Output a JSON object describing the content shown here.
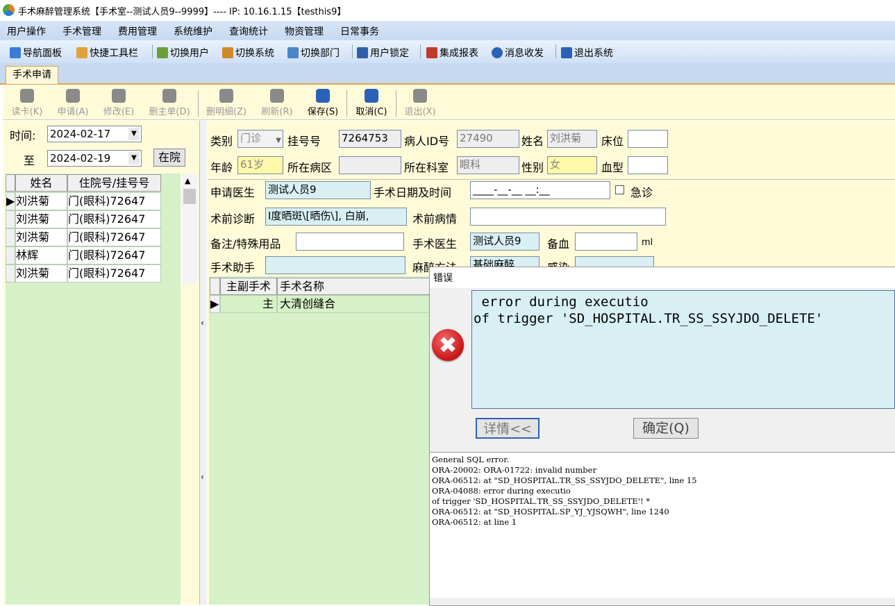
{
  "window": {
    "title": "手术麻醉管理系统【手术室--测试人员9--9999】---- IP:  10.16.1.15【testhis9】"
  },
  "menu": [
    "用户操作",
    "手术管理",
    "费用管理",
    "系统维护",
    "查询统计",
    "物资管理",
    "日常事务"
  ],
  "toolbar": [
    "导航面板",
    "快捷工具栏",
    "切换用户",
    "切换系统",
    "切换部门",
    "用户锁定",
    "集成报表",
    "消息收发",
    "退出系统"
  ],
  "tab": "手术申请",
  "actions": [
    "读卡(K)",
    "申请(A)",
    "修改(E)",
    "删主单(D)",
    "删明细(Z)",
    "刷新(R)",
    "保存(S)",
    "取消(C)",
    "退出(X)"
  ],
  "left": {
    "time_label": "时间:",
    "date_from": "2024-02-17",
    "to_label": "至",
    "date_to": "2024-02-19",
    "inhosp_button": "在院",
    "columns": [
      "姓名",
      "住院号/挂号号"
    ],
    "rows": [
      [
        "刘洪菊",
        "门(眼科)72647"
      ],
      [
        "刘洪菊",
        "门(眼科)72647"
      ],
      [
        "刘洪菊",
        "门(眼科)72647"
      ],
      [
        "林辉",
        "门(眼科)72647"
      ],
      [
        "刘洪菊",
        "门(眼科)72647"
      ]
    ]
  },
  "form": {
    "category_label": "类别",
    "category": "门诊",
    "reg_label": "挂号号",
    "reg_no": "7264753",
    "pid_label": "病人ID号",
    "pid": "27490",
    "name_label": "姓名",
    "name": "刘洪菊",
    "bed_label": "床位",
    "bed": "",
    "age_label": "年龄",
    "age": "61岁",
    "ward_label": "所在病区",
    "ward": "",
    "dept_label": "所在科室",
    "dept": "眼科",
    "sex_label": "性别",
    "sex": "女",
    "blood_label": "血型",
    "blood": "",
    "doctor_label": "申请医生",
    "doctor": "测试人员9",
    "optime_label": "手术日期及时间",
    "optime": "____-__-__ __:__",
    "urgent_label": "急诊",
    "diag_label": "术前诊断",
    "diag": "Ⅰ度晒斑\\[晒伤\\], 白崩,",
    "cond_label": "术前病情",
    "cond": "",
    "remark_label": "备注/特殊用品",
    "remark": "",
    "surgeon_label": "手术医生",
    "surgeon": "测试人员9",
    "blood_prep_label": "备血",
    "blood_prep": "",
    "ml": "ml",
    "assistant_label": "手术助手",
    "assistant": "",
    "anes_label": "麻醉方法",
    "anes": "基础麻醉",
    "infect_label": "感染",
    "infect": ""
  },
  "opgrid": {
    "columns": [
      "主副手术",
      "手术名称"
    ],
    "rows": [
      [
        "主",
        "大清创缝合"
      ]
    ]
  },
  "dialog": {
    "title": "错误",
    "message": " error during executio\nof trigger 'SD_HOSPITAL.TR_SS_SSYJDO_DELETE'",
    "details_button": "详情<<",
    "ok_button": "确定(Q)",
    "details": "General SQL error.\nORA-20002: ORA-01722: invalid number\nORA-06512: at \"SD_HOSPITAL.TR_SS_SSYJDO_DELETE\", line 15\nORA-04088: error during executio\nof trigger 'SD_HOSPITAL.TR_SS_SSYJDO_DELETE'! *\nORA-06512: at \"SD_HOSPITAL.SP_YJ_YJSQWH\", line 1240\nORA-06512: at line 1"
  },
  "colors": {
    "accent": "#e8a33a",
    "form_bg": "#fffbd9",
    "grid_bg": "#d6f0c8",
    "input_cyan": "#d8f0f4",
    "input_yellow": "#fff8a8"
  }
}
